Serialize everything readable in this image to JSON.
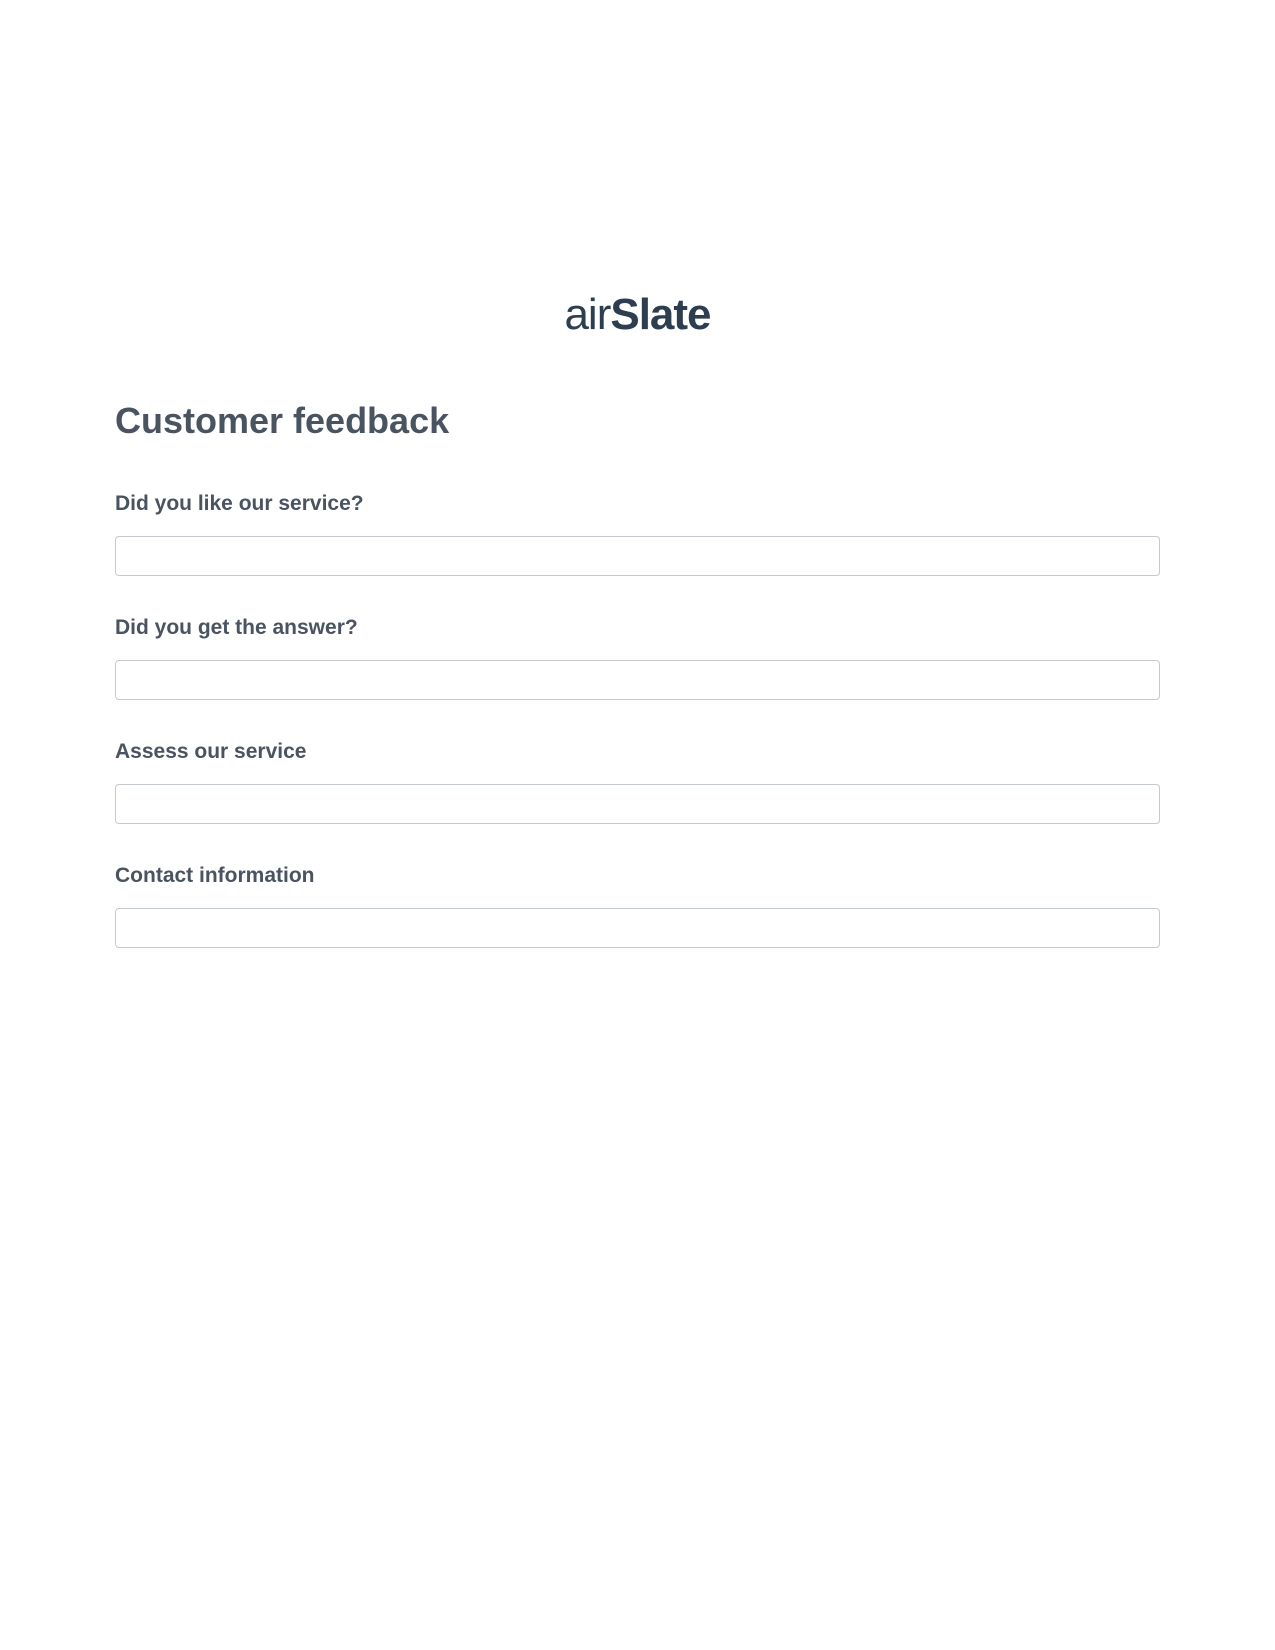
{
  "logo": {
    "part1": "air",
    "part2": "Slate"
  },
  "form": {
    "title": "Customer feedback",
    "fields": [
      {
        "label": "Did you like our service?",
        "value": ""
      },
      {
        "label": "Did you get the answer?",
        "value": ""
      },
      {
        "label": "Assess our service",
        "value": ""
      },
      {
        "label": "Contact information",
        "value": ""
      }
    ]
  }
}
